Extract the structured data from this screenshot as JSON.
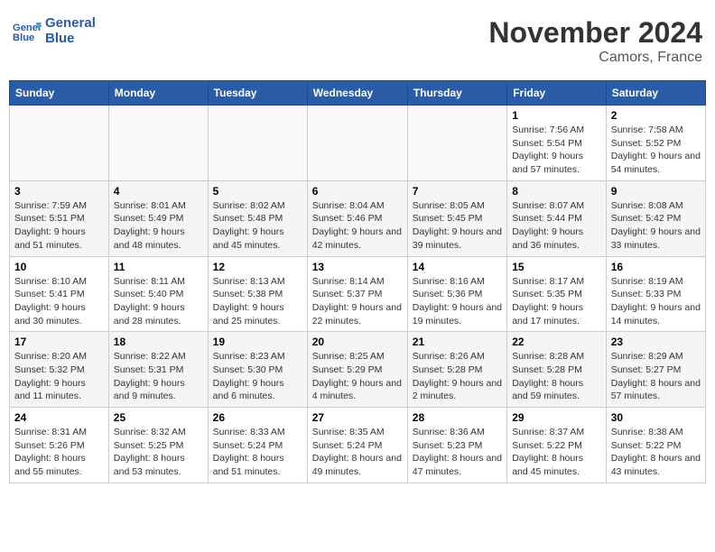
{
  "logo": {
    "line1": "General",
    "line2": "Blue"
  },
  "title": "November 2024",
  "location": "Camors, France",
  "days_of_week": [
    "Sunday",
    "Monday",
    "Tuesday",
    "Wednesday",
    "Thursday",
    "Friday",
    "Saturday"
  ],
  "weeks": [
    [
      {
        "day": "",
        "empty": true
      },
      {
        "day": "",
        "empty": true
      },
      {
        "day": "",
        "empty": true
      },
      {
        "day": "",
        "empty": true
      },
      {
        "day": "",
        "empty": true
      },
      {
        "day": "1",
        "sunrise": "7:56 AM",
        "sunset": "5:54 PM",
        "daylight": "9 hours and 57 minutes."
      },
      {
        "day": "2",
        "sunrise": "7:58 AM",
        "sunset": "5:52 PM",
        "daylight": "9 hours and 54 minutes."
      }
    ],
    [
      {
        "day": "3",
        "sunrise": "7:59 AM",
        "sunset": "5:51 PM",
        "daylight": "9 hours and 51 minutes."
      },
      {
        "day": "4",
        "sunrise": "8:01 AM",
        "sunset": "5:49 PM",
        "daylight": "9 hours and 48 minutes."
      },
      {
        "day": "5",
        "sunrise": "8:02 AM",
        "sunset": "5:48 PM",
        "daylight": "9 hours and 45 minutes."
      },
      {
        "day": "6",
        "sunrise": "8:04 AM",
        "sunset": "5:46 PM",
        "daylight": "9 hours and 42 minutes."
      },
      {
        "day": "7",
        "sunrise": "8:05 AM",
        "sunset": "5:45 PM",
        "daylight": "9 hours and 39 minutes."
      },
      {
        "day": "8",
        "sunrise": "8:07 AM",
        "sunset": "5:44 PM",
        "daylight": "9 hours and 36 minutes."
      },
      {
        "day": "9",
        "sunrise": "8:08 AM",
        "sunset": "5:42 PM",
        "daylight": "9 hours and 33 minutes."
      }
    ],
    [
      {
        "day": "10",
        "sunrise": "8:10 AM",
        "sunset": "5:41 PM",
        "daylight": "9 hours and 30 minutes."
      },
      {
        "day": "11",
        "sunrise": "8:11 AM",
        "sunset": "5:40 PM",
        "daylight": "9 hours and 28 minutes."
      },
      {
        "day": "12",
        "sunrise": "8:13 AM",
        "sunset": "5:38 PM",
        "daylight": "9 hours and 25 minutes."
      },
      {
        "day": "13",
        "sunrise": "8:14 AM",
        "sunset": "5:37 PM",
        "daylight": "9 hours and 22 minutes."
      },
      {
        "day": "14",
        "sunrise": "8:16 AM",
        "sunset": "5:36 PM",
        "daylight": "9 hours and 19 minutes."
      },
      {
        "day": "15",
        "sunrise": "8:17 AM",
        "sunset": "5:35 PM",
        "daylight": "9 hours and 17 minutes."
      },
      {
        "day": "16",
        "sunrise": "8:19 AM",
        "sunset": "5:33 PM",
        "daylight": "9 hours and 14 minutes."
      }
    ],
    [
      {
        "day": "17",
        "sunrise": "8:20 AM",
        "sunset": "5:32 PM",
        "daylight": "9 hours and 11 minutes."
      },
      {
        "day": "18",
        "sunrise": "8:22 AM",
        "sunset": "5:31 PM",
        "daylight": "9 hours and 9 minutes."
      },
      {
        "day": "19",
        "sunrise": "8:23 AM",
        "sunset": "5:30 PM",
        "daylight": "9 hours and 6 minutes."
      },
      {
        "day": "20",
        "sunrise": "8:25 AM",
        "sunset": "5:29 PM",
        "daylight": "9 hours and 4 minutes."
      },
      {
        "day": "21",
        "sunrise": "8:26 AM",
        "sunset": "5:28 PM",
        "daylight": "9 hours and 2 minutes."
      },
      {
        "day": "22",
        "sunrise": "8:28 AM",
        "sunset": "5:28 PM",
        "daylight": "8 hours and 59 minutes."
      },
      {
        "day": "23",
        "sunrise": "8:29 AM",
        "sunset": "5:27 PM",
        "daylight": "8 hours and 57 minutes."
      }
    ],
    [
      {
        "day": "24",
        "sunrise": "8:31 AM",
        "sunset": "5:26 PM",
        "daylight": "8 hours and 55 minutes."
      },
      {
        "day": "25",
        "sunrise": "8:32 AM",
        "sunset": "5:25 PM",
        "daylight": "8 hours and 53 minutes."
      },
      {
        "day": "26",
        "sunrise": "8:33 AM",
        "sunset": "5:24 PM",
        "daylight": "8 hours and 51 minutes."
      },
      {
        "day": "27",
        "sunrise": "8:35 AM",
        "sunset": "5:24 PM",
        "daylight": "8 hours and 49 minutes."
      },
      {
        "day": "28",
        "sunrise": "8:36 AM",
        "sunset": "5:23 PM",
        "daylight": "8 hours and 47 minutes."
      },
      {
        "day": "29",
        "sunrise": "8:37 AM",
        "sunset": "5:22 PM",
        "daylight": "8 hours and 45 minutes."
      },
      {
        "day": "30",
        "sunrise": "8:38 AM",
        "sunset": "5:22 PM",
        "daylight": "8 hours and 43 minutes."
      }
    ]
  ],
  "labels": {
    "sunrise": "Sunrise:",
    "sunset": "Sunset:",
    "daylight": "Daylight:"
  }
}
